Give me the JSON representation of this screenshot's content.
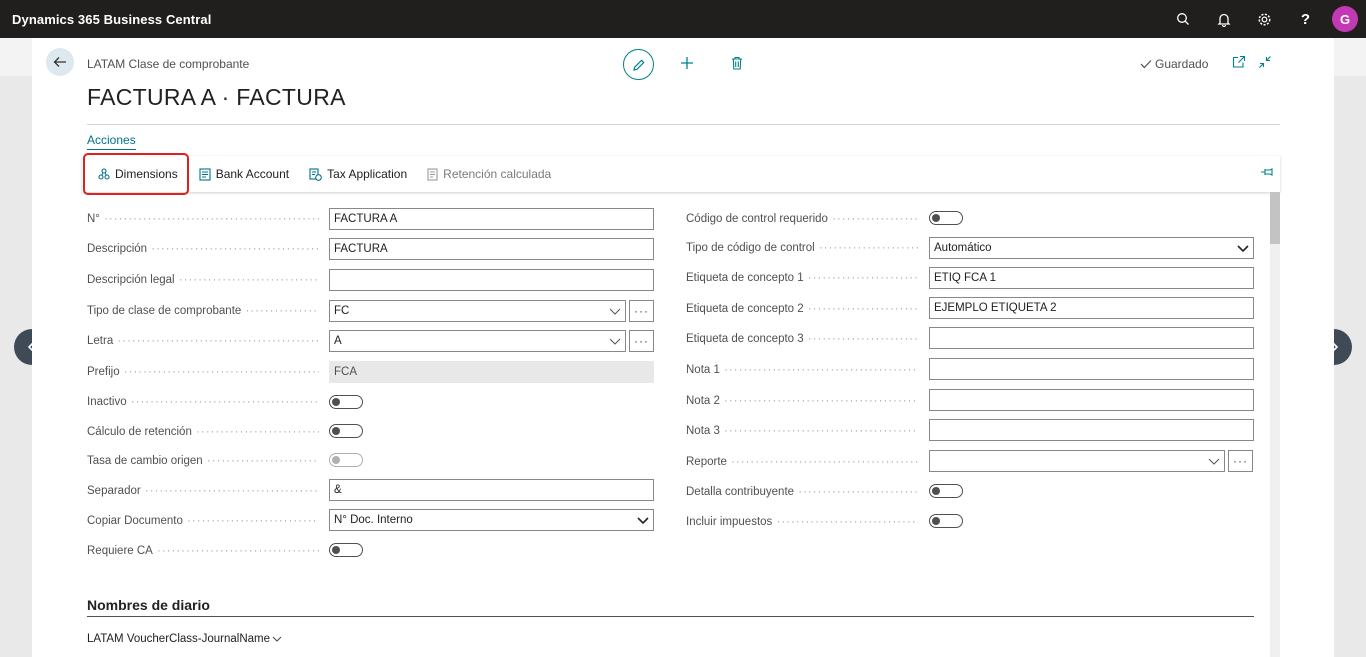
{
  "app": {
    "title": "Dynamics 365 Business Central",
    "user_initial": "G"
  },
  "header": {
    "caption": "LATAM Clase de comprobante",
    "title": "FACTURA A · FACTURA",
    "saved_label": "Guardado"
  },
  "actions": {
    "tab_label": "Acciones",
    "items": [
      {
        "label": "Dimensions",
        "icon": "dimensions-icon"
      },
      {
        "label": "Bank Account",
        "icon": "bank-account-icon"
      },
      {
        "label": "Tax Application",
        "icon": "tax-application-icon"
      },
      {
        "label": "Retención calculada",
        "icon": "document-icon"
      }
    ]
  },
  "left_fields": [
    {
      "label": "N°",
      "type": "text",
      "value": "FACTURA A"
    },
    {
      "label": "Descripción",
      "type": "text",
      "value": "FACTURA"
    },
    {
      "label": "Descripción legal",
      "type": "text",
      "value": ""
    },
    {
      "label": "Tipo de clase de comprobante",
      "type": "lookup",
      "value": "FC"
    },
    {
      "label": "Letra",
      "type": "lookup",
      "value": "A"
    },
    {
      "label": "Prefijo",
      "type": "readonly",
      "value": "FCA"
    },
    {
      "label": "Inactivo",
      "type": "toggle",
      "value": false
    },
    {
      "label": "Cálculo de retención",
      "type": "toggle",
      "value": false
    },
    {
      "label": "Tasa de cambio origen",
      "type": "toggle_disabled",
      "value": false
    },
    {
      "label": "Separador",
      "type": "text",
      "value": "&"
    },
    {
      "label": "Copiar Documento",
      "type": "select",
      "value": "N° Doc. Interno"
    },
    {
      "label": "Requiere CA",
      "type": "toggle",
      "value": false
    }
  ],
  "right_fields": [
    {
      "label": "Código de control requerido",
      "type": "toggle",
      "value": false
    },
    {
      "label": "Tipo de código de control",
      "type": "select",
      "value": "Automático"
    },
    {
      "label": "Etiqueta de concepto 1",
      "type": "text",
      "value": "ETIQ FCA 1"
    },
    {
      "label": "Etiqueta de concepto 2",
      "type": "text",
      "value": "EJEMPLO ETIQUETA 2"
    },
    {
      "label": "Etiqueta de concepto 3",
      "type": "text",
      "value": ""
    },
    {
      "label": "Nota 1",
      "type": "text",
      "value": ""
    },
    {
      "label": "Nota 2",
      "type": "text",
      "value": ""
    },
    {
      "label": "Nota 3",
      "type": "text",
      "value": ""
    },
    {
      "label": "Reporte",
      "type": "lookup",
      "value": ""
    },
    {
      "label": "Detalla contribuyente",
      "type": "toggle",
      "value": false
    },
    {
      "label": "Incluir impuestos",
      "type": "toggle",
      "value": false
    }
  ],
  "section": {
    "title": "Nombres de diario",
    "subsection": "LATAM VoucherClass-JournalName"
  },
  "colors": {
    "accent": "#00828a",
    "topbar": "#201f1e",
    "avatar": "#c239b3",
    "highlight": "#e02020"
  }
}
